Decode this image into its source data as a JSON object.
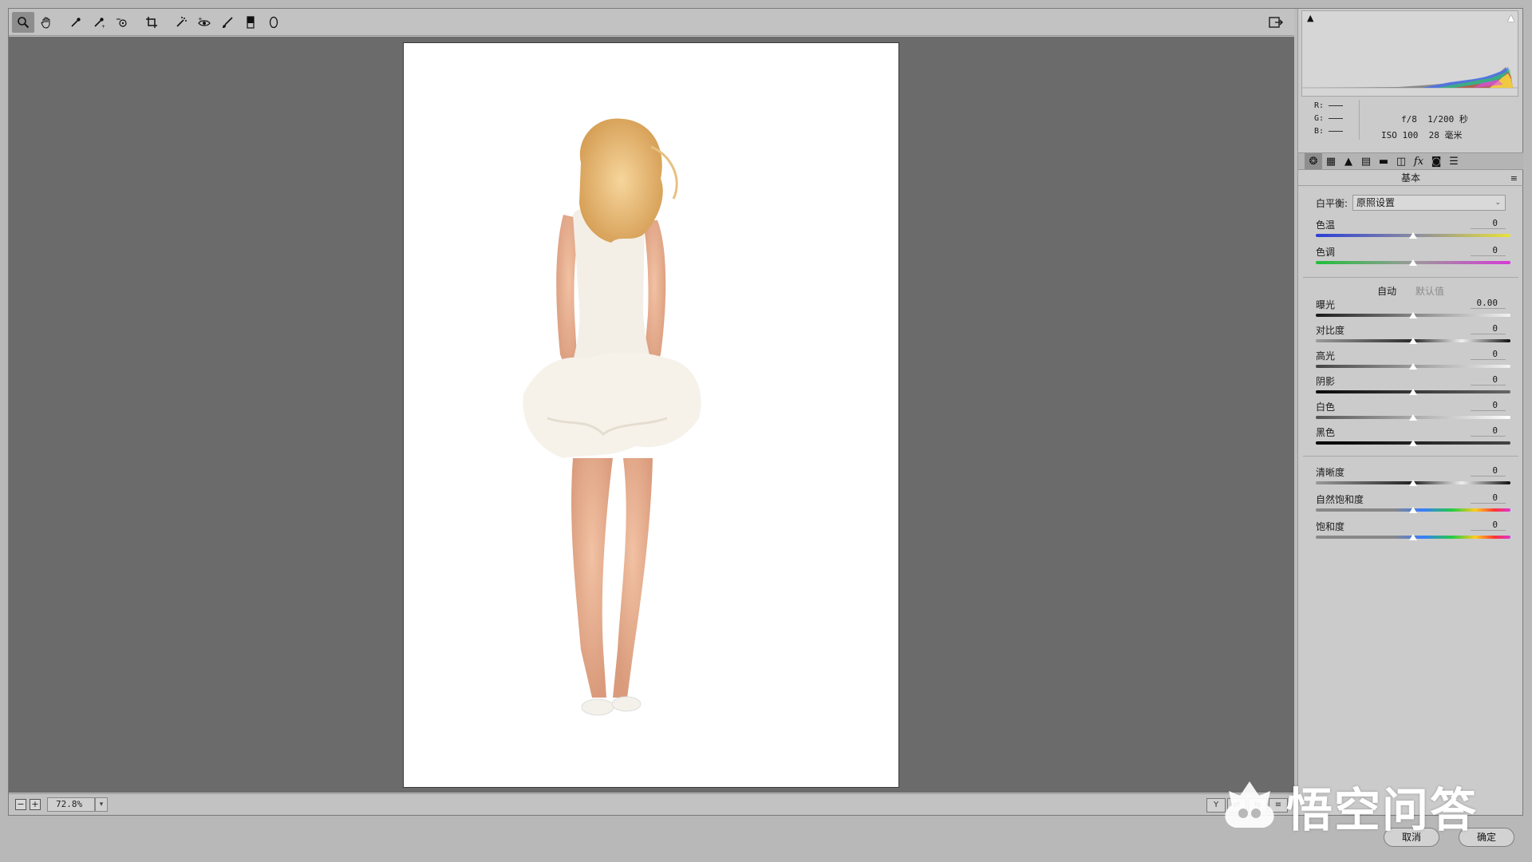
{
  "toolbar": {
    "tools": [
      {
        "name": "zoom-tool",
        "icon": "magnifier-icon",
        "glyph": "🔍"
      },
      {
        "name": "hand-tool",
        "icon": "hand-icon",
        "glyph": "✋"
      },
      {
        "name": "white-balance-tool",
        "icon": "eyedropper-icon",
        "glyph": "✎"
      },
      {
        "name": "color-sampler-tool",
        "icon": "color-sampler-icon",
        "glyph": "✐"
      },
      {
        "name": "targeted-adjustment-tool",
        "icon": "target-adjust-icon",
        "glyph": "⊙"
      },
      {
        "name": "crop-tool",
        "icon": "crop-icon",
        "glyph": "⌗"
      },
      {
        "name": "spot-removal-tool",
        "icon": "spot-removal-icon",
        "glyph": "✧"
      },
      {
        "name": "red-eye-tool",
        "icon": "red-eye-icon",
        "glyph": "◉"
      },
      {
        "name": "adjustment-brush-tool",
        "icon": "brush-icon",
        "glyph": "🖌"
      },
      {
        "name": "graduated-filter-tool",
        "icon": "graduated-filter-icon",
        "glyph": "▮"
      },
      {
        "name": "radial-filter-tool",
        "icon": "radial-filter-icon",
        "glyph": "○"
      }
    ],
    "exit_icon": "fullscreen-toggle-icon"
  },
  "status": {
    "zoom": "72.8%"
  },
  "info": {
    "r_label": "R:",
    "g_label": "G:",
    "b_label": "B:",
    "aperture": "f/8",
    "shutter": "1/200 秒",
    "iso": "ISO 100",
    "focal": "28 毫米"
  },
  "panel": {
    "section_title": "基本",
    "white_balance_label": "白平衡:",
    "white_balance_value": "原照设置",
    "auto_label": "自动",
    "default_label": "默认值"
  },
  "sliders": {
    "temperature": {
      "label": "色温",
      "value": "0",
      "position": 0.5
    },
    "tint": {
      "label": "色调",
      "value": "0",
      "position": 0.5
    },
    "exposure": {
      "label": "曝光",
      "value": "0.00",
      "position": 0.5
    },
    "contrast": {
      "label": "对比度",
      "value": "0",
      "position": 0.5
    },
    "highlights": {
      "label": "高光",
      "value": "0",
      "position": 0.5
    },
    "shadows": {
      "label": "阴影",
      "value": "0",
      "position": 0.5
    },
    "whites": {
      "label": "白色",
      "value": "0",
      "position": 0.5
    },
    "blacks": {
      "label": "黑色",
      "value": "0",
      "position": 0.5
    },
    "clarity": {
      "label": "清晰度",
      "value": "0",
      "position": 0.5
    },
    "vibrance": {
      "label": "自然饱和度",
      "value": "0",
      "position": 0.5
    },
    "saturation": {
      "label": "饱和度",
      "value": "0",
      "position": 0.5
    }
  },
  "buttons": {
    "cancel": "取消",
    "ok": "确定"
  },
  "watermark": {
    "text": "悟空问答"
  },
  "colors": {
    "canvas_bg": "#6b6b6b",
    "panel_bg": "#cbcbcb"
  }
}
